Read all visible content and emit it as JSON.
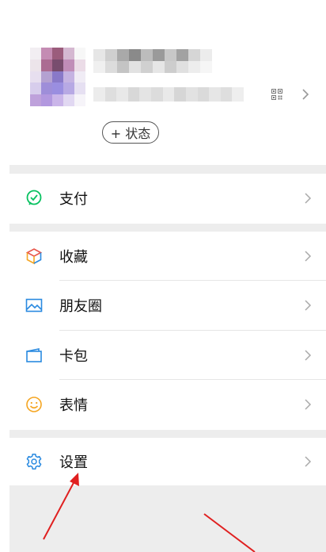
{
  "profile": {
    "status_label": "+ 状态"
  },
  "menu": {
    "pay": {
      "label": "支付",
      "icon": "wechat-pay-icon"
    },
    "favorites": {
      "label": "收藏",
      "icon": "cube-icon"
    },
    "moments": {
      "label": "朋友圈",
      "icon": "photo-icon"
    },
    "card": {
      "label": "卡包",
      "icon": "wallet-icon"
    },
    "stickers": {
      "label": "表情",
      "icon": "smile-icon"
    },
    "settings": {
      "label": "设置",
      "icon": "gear-icon"
    }
  },
  "colors": {
    "pay": "#07c160",
    "annotation": "#e02020",
    "icon_blue": "#2a8ae0"
  }
}
